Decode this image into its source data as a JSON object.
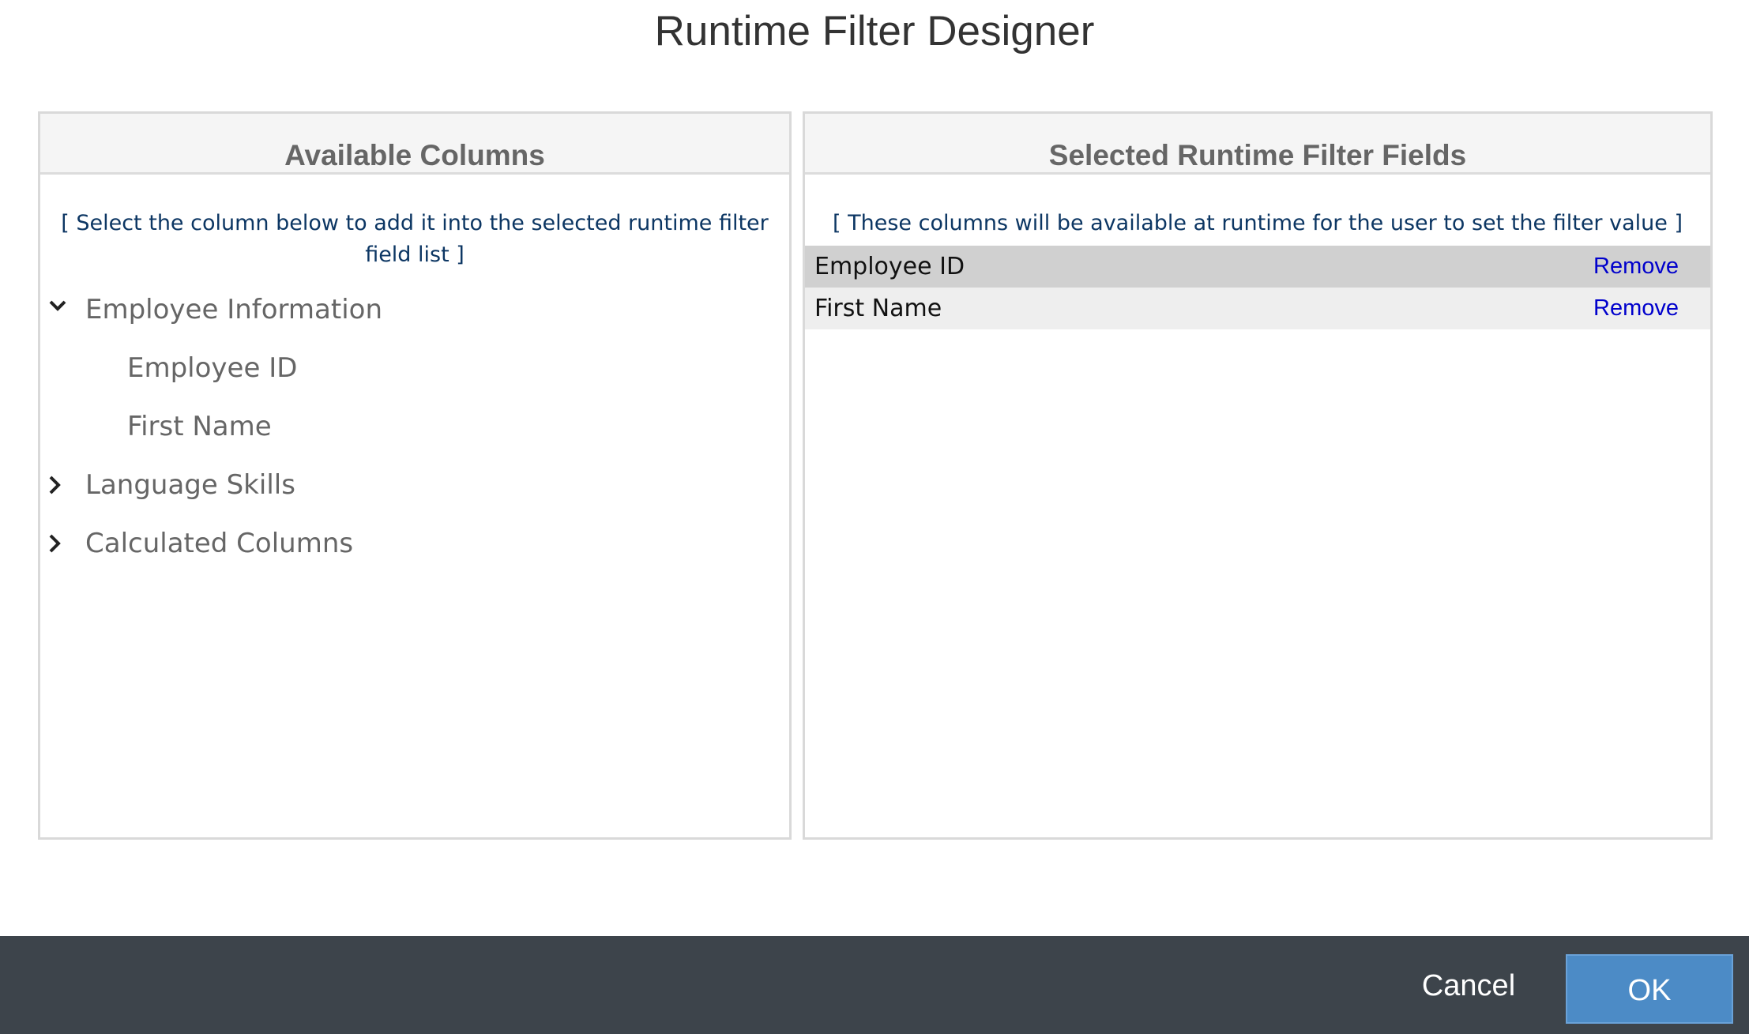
{
  "dialog": {
    "title": "Runtime Filter Designer"
  },
  "available_panel": {
    "header": "Available Columns",
    "hint": "[ Select the column below to add it into the selected runtime filter field list ]",
    "tree": [
      {
        "label": "Employee Information",
        "expanded": true,
        "icon": "chevron-down-icon"
      },
      {
        "label": "Employee ID",
        "child": true
      },
      {
        "label": "First Name",
        "child": true
      },
      {
        "label": "Language Skills",
        "expanded": false,
        "icon": "chevron-right-icon"
      },
      {
        "label": "Calculated Columns",
        "expanded": false,
        "icon": "chevron-right-icon"
      }
    ]
  },
  "selected_panel": {
    "header": "Selected Runtime Filter Fields",
    "hint": "[ These columns will be available at runtime for the user to set the filter value ]",
    "fields": [
      {
        "label": "Employee ID",
        "action": "Remove",
        "selected": true
      },
      {
        "label": "First Name",
        "action": "Remove",
        "selected": false
      }
    ]
  },
  "footer": {
    "cancel_label": "Cancel",
    "ok_label": "OK"
  },
  "colors": {
    "footer_bg": "#3d444b",
    "ok_button": "#4c8bc6",
    "link": "#0000cc",
    "hint": "#0c3663",
    "selected_row": "#d0d0d0",
    "alt_row": "#eeeeee"
  }
}
